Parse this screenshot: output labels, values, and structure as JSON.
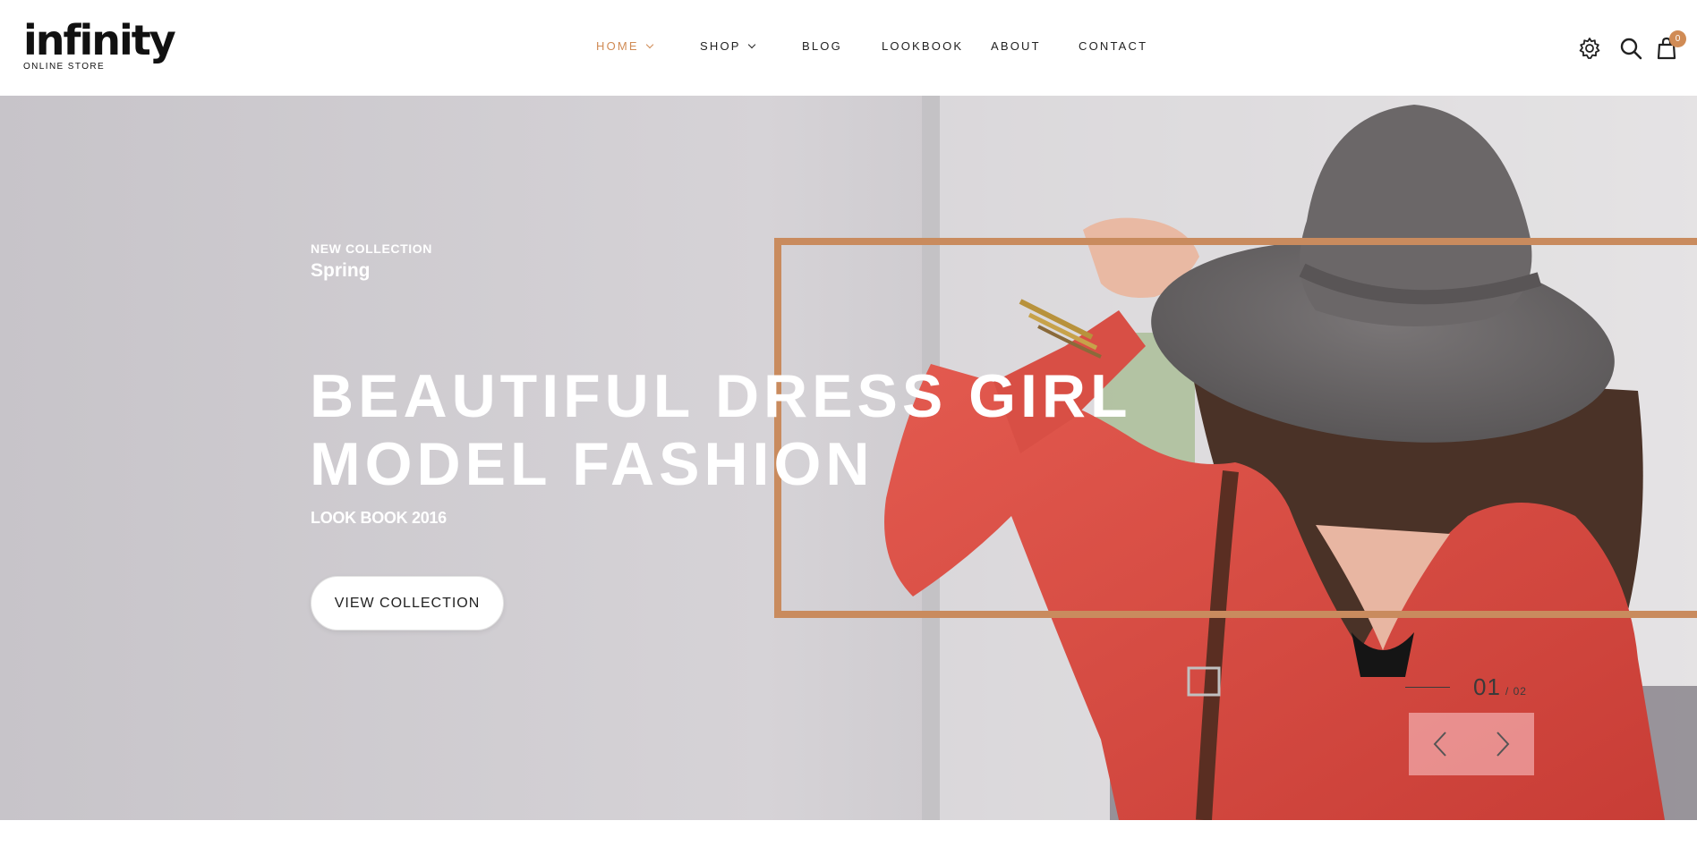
{
  "brand": {
    "name": "infinity",
    "tagline": "ONLINE STORE"
  },
  "nav": {
    "items": [
      {
        "label": "HOME",
        "active": true,
        "has_dropdown": true
      },
      {
        "label": "SHOP",
        "active": false,
        "has_dropdown": true
      },
      {
        "label": "BLOG",
        "active": false,
        "has_dropdown": false
      },
      {
        "label": "LOOKBOOK",
        "active": false,
        "has_dropdown": false
      },
      {
        "label": "ABOUT",
        "active": false,
        "has_dropdown": false
      },
      {
        "label": "CONTACT",
        "active": false,
        "has_dropdown": false
      }
    ]
  },
  "header_icons": {
    "settings": "gear-icon",
    "search": "search-icon",
    "cart": "bag-icon",
    "cart_count": "0"
  },
  "hero": {
    "eyebrow": "NEW COLLECTION",
    "season": "Spring",
    "title_line1": "BEAUTIFUL DRESS GIRL",
    "title_line2": "MODEL FASHION",
    "subtitle": "LOOK BOOK 2016",
    "cta_label": "VIEW COLLECTION",
    "slide_current": "01",
    "slide_total": "/ 02",
    "prev_icon": "chevron-left-icon",
    "next_icon": "chevron-right-icon"
  },
  "colors": {
    "accent": "#d08b55",
    "frame": "#c98b5e",
    "text_dark": "#222222",
    "white": "#ffffff"
  }
}
